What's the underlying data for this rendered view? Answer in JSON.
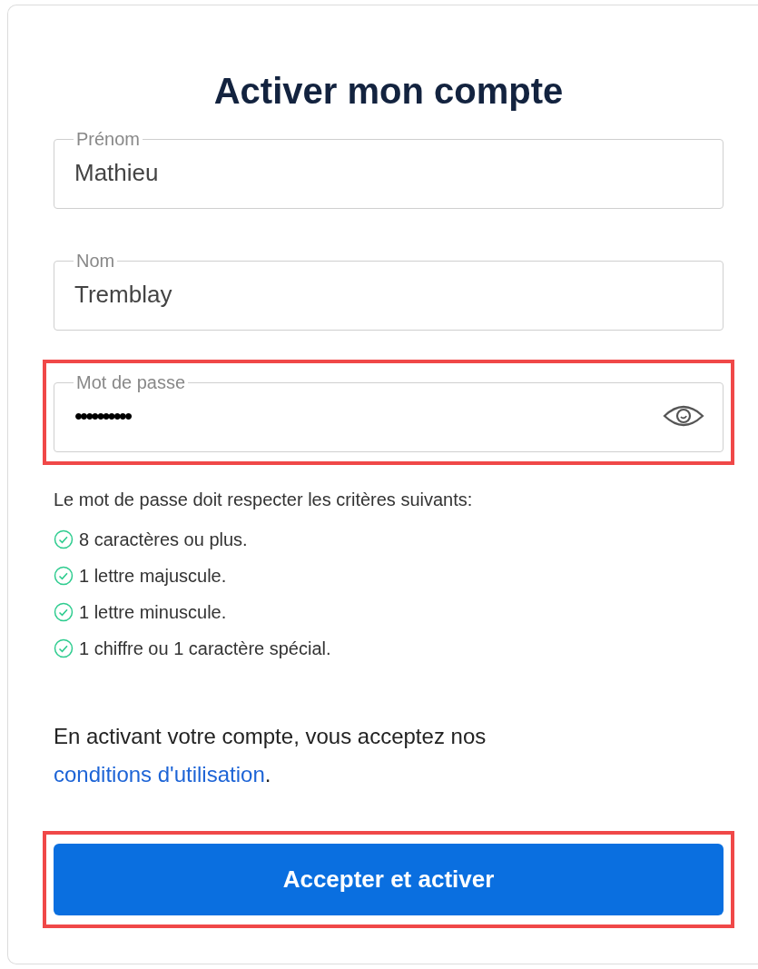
{
  "title": "Activer mon compte",
  "fields": [
    {
      "label": "Prénom",
      "value": "Mathieu",
      "highlighted": false,
      "reveal_toggle": false
    },
    {
      "label": "Nom",
      "value": "Tremblay",
      "highlighted": false,
      "reveal_toggle": false
    },
    {
      "label": "Mot de passe",
      "value": "••••••••••",
      "highlighted": true,
      "reveal_toggle": true
    }
  ],
  "criteria": {
    "heading": "Le mot de passe doit respecter les critères suivants:",
    "items": [
      {
        "text": "8 caractères ou plus.",
        "met": true
      },
      {
        "text": "1 lettre majuscule.",
        "met": true
      },
      {
        "text": "1 lettre minuscule.",
        "met": true
      },
      {
        "text": "1 chiffre ou 1 caractère spécial.",
        "met": true
      }
    ]
  },
  "consent": {
    "text": "En activant votre compte, vous acceptez nos",
    "link": "conditions d'utilisation",
    "after": "."
  },
  "submit": {
    "label": "Accepter et activer",
    "highlighted": true
  }
}
